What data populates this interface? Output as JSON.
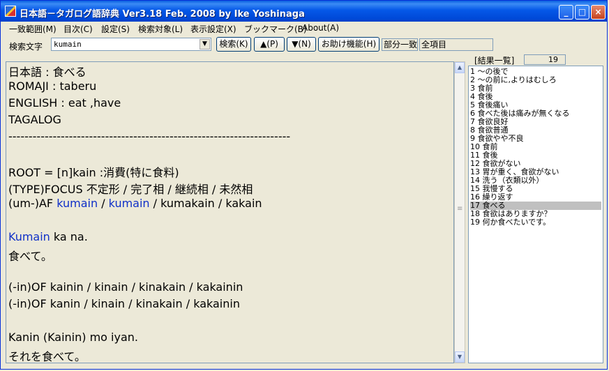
{
  "window": {
    "title": "日本語－タガログ語辞典 Ver3.18  Feb. 2008  by Ike Yoshinaga",
    "controls": {
      "minimize": "_",
      "maximize": "□",
      "close": "×"
    }
  },
  "menu": [
    "一致範囲(M)",
    "目次(C)",
    "設定(S)",
    "検索対象(L)",
    "表示設定(X)",
    "ブックマーク(B)",
    "About(A)"
  ],
  "toolbar": {
    "search_label": "検索文字",
    "search_value": "kumain",
    "search_button": "検索(K)",
    "up_button": "▲(P)",
    "down_button": "▼(N)",
    "help_button": "お助け機能(H)",
    "match_mode": "部分一致",
    "scope": "全項目"
  },
  "main": {
    "lines": [
      [
        {
          "t": "日本語 : 食べる"
        }
      ],
      [
        {
          "t": "ROMAJI : taberu"
        }
      ],
      [
        {
          "t": "ENGLISH : eat ,have"
        }
      ],
      [
        {
          "t": "TAGALOG"
        }
      ],
      [
        {
          "t": "----------------------------------------------------------------------"
        }
      ],
      [],
      [
        {
          "t": " ROOT = [n]kain :消費(特に食料)"
        }
      ],
      [
        {
          "t": "(TYPE)FOCUS  不定形 / 完了相 / 継続相 / 未然相"
        }
      ],
      [
        {
          "t": "(um-)AF   "
        },
        {
          "t": "kumain",
          "c": "blue"
        },
        {
          "t": " / "
        },
        {
          "t": "kumain",
          "c": "blue"
        },
        {
          "t": " / kumakain / kakain"
        }
      ],
      [],
      [
        {
          "t": "  "
        },
        {
          "t": "Kumain",
          "c": "blue"
        },
        {
          "t": " ka na."
        }
      ],
      [
        {
          "t": "  食べて。"
        }
      ],
      [],
      [
        {
          "t": "(-in)OF   kainin / kinain / kinakain / kakainin"
        }
      ],
      [
        {
          "t": "(-in)OF   kanin / kinain / kinakain / kakainin"
        }
      ],
      [],
      [
        {
          "t": "  Kanin (Kainin) mo iyan."
        }
      ],
      [
        {
          "t": "  それを食べて。"
        }
      ]
    ]
  },
  "results": {
    "label": "[結果一覧]",
    "count": "19",
    "selected_index": 16,
    "items": [
      "1 ～の後で",
      "2 ～の前に,よりはむしろ",
      "3 食前",
      "4 食後",
      "5 食後痛い",
      "6 食べた後は痛みが無くなる",
      "7 食欲良好",
      "8 食欲普通",
      "9 食欲やや不良",
      "10 食前",
      "11 食後",
      "12 食欲がない",
      "13 胃が重く、食欲がない",
      "14 洗う（衣類以外）",
      "15 我慢する",
      "16 繰り返す",
      "17 食べる",
      "18 食欲はありますか？",
      "19 何か食べたいです。"
    ]
  },
  "colors": {
    "link_blue": "#1030C8",
    "title_blue": "#0558E8",
    "selection_gray": "#C0C0C0"
  }
}
